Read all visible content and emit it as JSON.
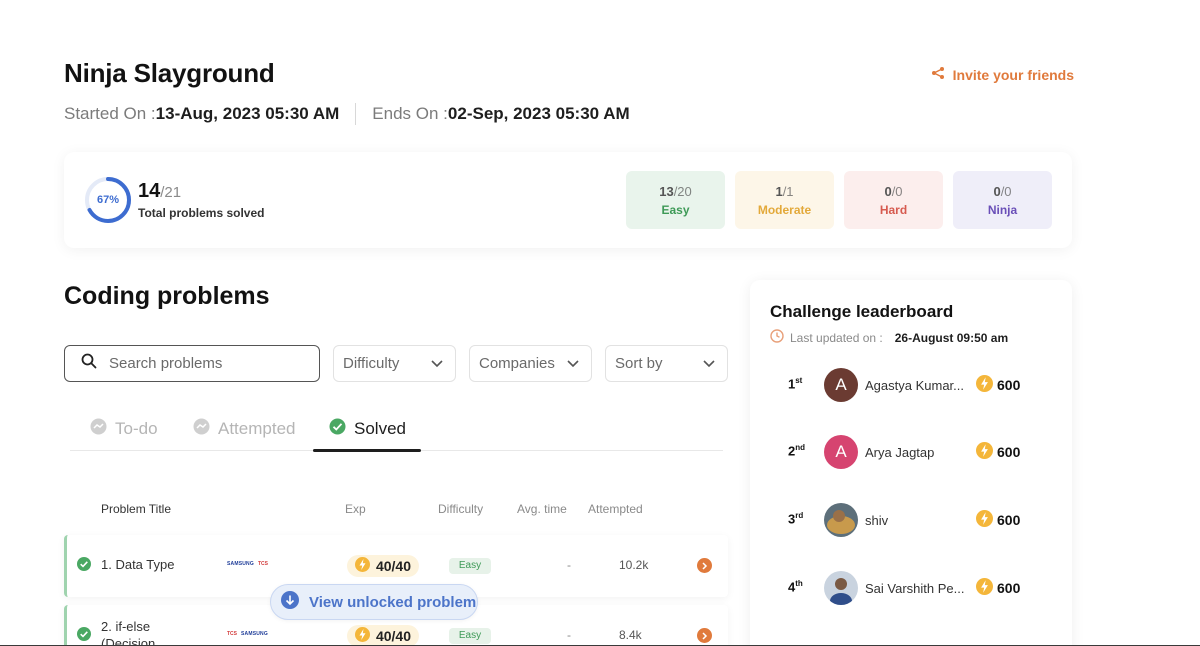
{
  "header": {
    "title": "Ninja Slayground",
    "started_label": "Started On :",
    "started_value": "13-Aug, 2023 05:30 AM",
    "ends_label": "Ends On :",
    "ends_value": "02-Sep, 2023 05:30 AM",
    "invite_label": "Invite your friends"
  },
  "summary": {
    "percent": "67%",
    "percent_value": 0.67,
    "solved": "14",
    "total": "/21",
    "label": "Total problems solved",
    "difficulties": [
      {
        "count": "13",
        "total": "/20",
        "label": "Easy"
      },
      {
        "count": "1",
        "total": "/1",
        "label": "Moderate"
      },
      {
        "count": "0",
        "total": "/0",
        "label": "Hard"
      },
      {
        "count": "0",
        "total": "/0",
        "label": "Ninja"
      }
    ]
  },
  "problems": {
    "title": "Coding problems",
    "search_placeholder": "Search problems",
    "filters": [
      "Difficulty",
      "Companies",
      "Sort by"
    ],
    "tabs": [
      "To-do",
      "Attempted",
      "Solved"
    ],
    "active_tab": "Solved",
    "columns": [
      "Problem Title",
      "Exp",
      "Difficulty",
      "Avg. time",
      "Attempted"
    ],
    "rows": [
      {
        "title": "1. Data Type",
        "logos": [
          "SAMSUNG",
          "TCS"
        ],
        "exp": "40/40",
        "difficulty": "Easy",
        "avg_time": "-",
        "attempted": "10.2k"
      },
      {
        "title": "2. if-else",
        "title_line2": "(Decision",
        "logos": [
          "TCS",
          "SAMSUNG"
        ],
        "exp": "40/40",
        "difficulty": "Easy",
        "avg_time": "-",
        "attempted": "8.4k"
      }
    ],
    "unlock_label": "View unlocked problem"
  },
  "leaderboard": {
    "title": "Challenge leaderboard",
    "updated_label": "Last updated on :",
    "updated_value": "26-August 09:50 am",
    "entries": [
      {
        "rank": "1",
        "suffix": "st",
        "initial": "A",
        "name": "Agastya Kumar...",
        "score": "600",
        "avatar_color": "#6b3b32"
      },
      {
        "rank": "2",
        "suffix": "nd",
        "initial": "A",
        "name": "Arya Jagtap",
        "score": "600",
        "avatar_color": "#d64470"
      },
      {
        "rank": "3",
        "suffix": "rd",
        "initial": "",
        "name": "shiv",
        "score": "600",
        "avatar_color": "#8a6a3a"
      },
      {
        "rank": "4",
        "suffix": "th",
        "initial": "",
        "name": "Sai Varshith Pe...",
        "score": "600",
        "avatar_color": "#7d8fa8"
      }
    ]
  },
  "colors": {
    "accent_orange": "#e07a3c",
    "progress_blue": "#3d6cd0",
    "success_green": "#3e9a57"
  }
}
